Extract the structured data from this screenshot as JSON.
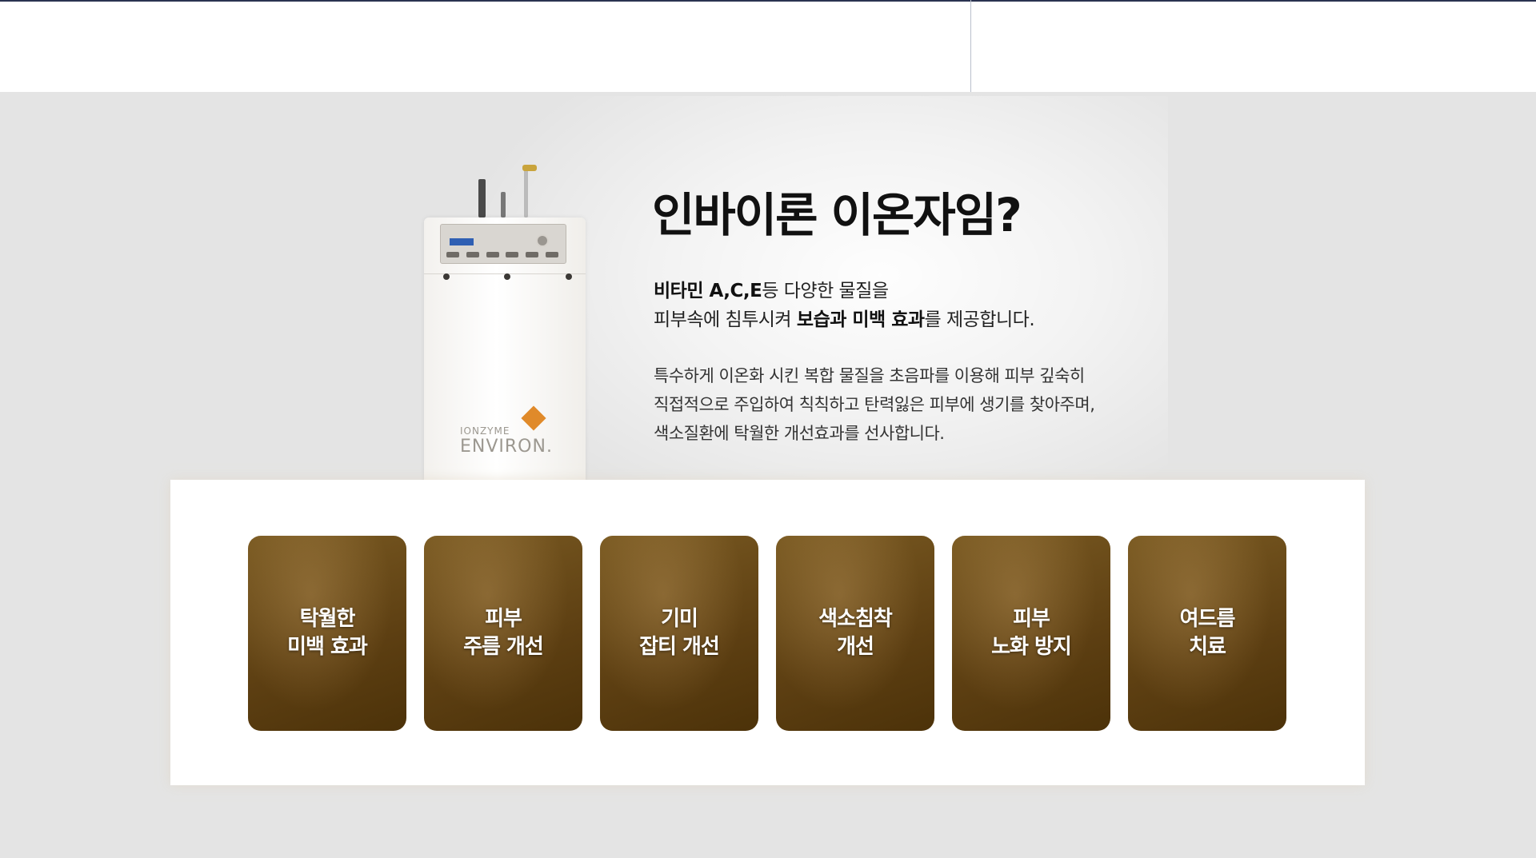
{
  "intro": {
    "title": "인바이론 이온자임?",
    "para1_line1_bold": "비타민 A,C,E",
    "para1_line1_rest": "등 다양한 물질을",
    "para1_line2_start": "피부속에 침투시켜 ",
    "para1_line2_bold": "보습과 미백 효과",
    "para1_line2_end": "를 제공합니다.",
    "para2_line1": "특수하게 이온화 시킨 복합 물질을 초음파를 이용해 피부 깊숙히",
    "para2_line2": "직접적으로 주입하여 칙칙하고 탄력잃은 피부에 생기를 찾아주며,",
    "para2_line3": "색소질환에 탁월한 개선효과를 선사합니다."
  },
  "device": {
    "brand_small": "IONZYME",
    "brand_big": "ENVIRON."
  },
  "effects": [
    {
      "label": "탁월한\n미백 효과"
    },
    {
      "label": "피부\n주름 개선"
    },
    {
      "label": "기미\n잡티 개선"
    },
    {
      "label": "색소침착\n개선"
    },
    {
      "label": "피부\n노화 방지"
    },
    {
      "label": "여드름\n치료"
    }
  ],
  "colors": {
    "card_brown": "#5d3f12",
    "logo_orange": "#e08a2a",
    "background_gray": "#e4e4e4"
  }
}
